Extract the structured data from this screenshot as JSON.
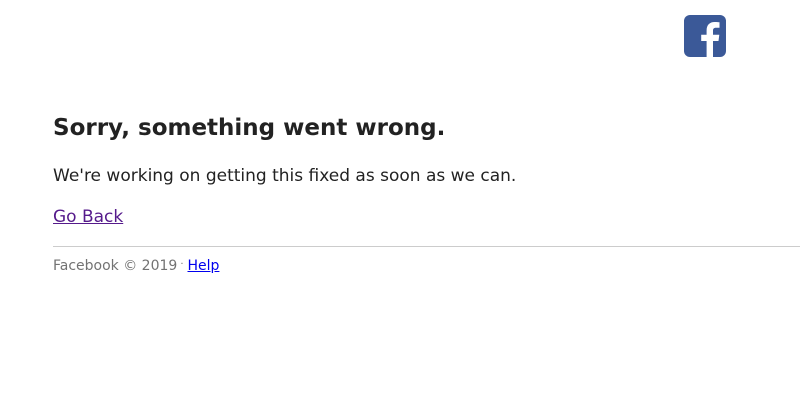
{
  "brand": {
    "logo_icon": "facebook-logo-icon",
    "logo_color": "#3b5998"
  },
  "error": {
    "title": "Sorry, something went wrong.",
    "message": "We're working on getting this fixed as soon as we can.",
    "go_back_label": "Go Back"
  },
  "footer": {
    "copyright": "Facebook © 2019",
    "separator": "·",
    "help_label": "Help"
  },
  "colors": {
    "text": "#222222",
    "visited_link": "#551a8b",
    "link": "#0000ee",
    "footer_text": "#737373",
    "divider": "#cccccc"
  }
}
